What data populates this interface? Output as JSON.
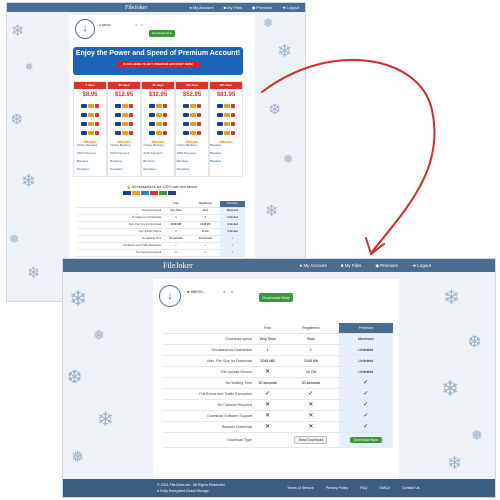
{
  "site": {
    "logo": "FileJoker",
    "nav": [
      {
        "icon": "user-icon",
        "label": "My Account"
      },
      {
        "icon": "folder-icon",
        "label": "My Files"
      },
      {
        "icon": "diamond-icon",
        "label": "Premium"
      },
      {
        "icon": "logout-icon",
        "label": "Logout"
      }
    ]
  },
  "file": {
    "name": "● 9BK90...",
    "meta": "4 ... 4",
    "download_label": "Download Now"
  },
  "promo": {
    "headline": "Enjoy the Power and Speed of Premium Account!",
    "cta": "CLICK HERE TO BUY PREMIUM ACCOUNT NOW!"
  },
  "plans": [
    {
      "period": "7 days",
      "price": "$8.95"
    },
    {
      "period": "30 days",
      "price": "$12.95"
    },
    {
      "period": "90 days",
      "price": "$32.95"
    },
    {
      "period": "180 days",
      "price": "$52.95"
    },
    {
      "period": "365 days",
      "price": "$81.95"
    }
  ],
  "payments": {
    "bitcoin": "bitcoin",
    "rows": [
      [
        "Online Banking",
        "Online Banking",
        "Online Banking",
        "Online Banking",
        "Bandera"
      ],
      [
        "SMS Payment",
        "SMS Payment",
        "SMS Payment",
        "SMS Payment",
        "Bandera"
      ],
      [
        "Bandera",
        "Bandera",
        "Bandera",
        "Bandera",
        "Bandera"
      ],
      [
        "Resellers",
        "Resellers",
        "Resellers",
        "Resellers"
      ]
    ],
    "secure_note": "All transactions are 100% safe and secure"
  },
  "comparison": {
    "headers": [
      "",
      "Free",
      "Registered",
      "Premium"
    ],
    "rows": [
      {
        "feature": "Download speed",
        "free": "Very Slow",
        "registered": "Slow",
        "premium": "Maximum"
      },
      {
        "feature": "Simultaneous Downloads",
        "free": "1",
        "registered": "1",
        "premium": "Unlimited"
      },
      {
        "feature": "Max. File Size for Download",
        "free": "2048 MB",
        "registered": "2048 Mb",
        "premium": "Unlimited"
      },
      {
        "feature": "File Upload Volume",
        "free": "x",
        "registered": "10 Gb",
        "premium": "Unlimited"
      },
      {
        "feature": "No Waiting Time",
        "free": "30 seconds",
        "registered": "30 seconds",
        "premium": "check"
      },
      {
        "feature": "Full Bonus and Traffic Exemption",
        "free": "check",
        "registered": "check",
        "premium": "check"
      },
      {
        "feature": "No Captcha Required",
        "free": "x",
        "registered": "x",
        "premium": "check"
      },
      {
        "feature": "Download Software Support",
        "free": "x",
        "registered": "x",
        "premium": "check"
      },
      {
        "feature": "Resume Download",
        "free": "x",
        "registered": "x",
        "premium": "check"
      },
      {
        "feature": "Download Type",
        "free": "",
        "registered": "Slow Download",
        "premium": "Download Now"
      }
    ]
  },
  "footer": {
    "copyright": "© 2021 FileJoker.net - All Rights Reserved",
    "secure": "Fully Encrypted Cloud Storage",
    "links": [
      "Terms of Service",
      "Privacy Policy",
      "FAQ",
      "DMCA",
      "Contact Us"
    ]
  },
  "colors": {
    "bar": "#4a6d92",
    "download": "#3a9a3a",
    "plan_header": "#d9342b",
    "arrow": "#d62b2b"
  }
}
